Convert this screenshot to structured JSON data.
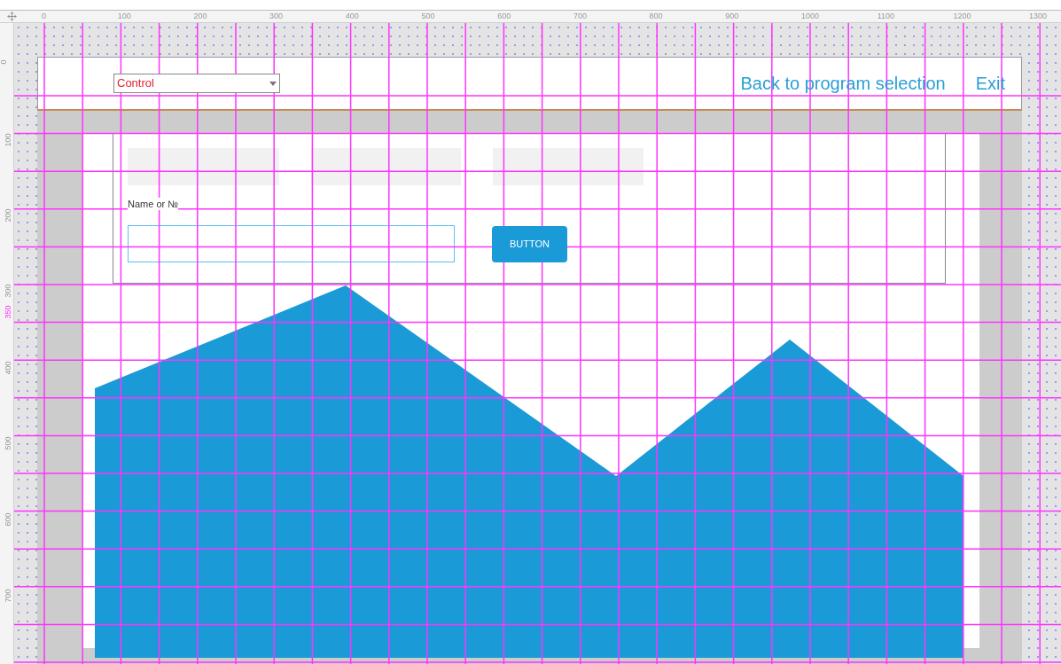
{
  "rulers": {
    "horizontal": [
      {
        "label": "0",
        "highlighted": false
      },
      {
        "label": "100",
        "highlighted": false
      },
      {
        "label": "200",
        "highlighted": false
      },
      {
        "label": "300",
        "highlighted": false
      },
      {
        "label": "400",
        "highlighted": false
      },
      {
        "label": "500",
        "highlighted": false
      },
      {
        "label": "600",
        "highlighted": false
      },
      {
        "label": "700",
        "highlighted": false
      },
      {
        "label": "800",
        "highlighted": false
      },
      {
        "label": "900",
        "highlighted": false
      },
      {
        "label": "1000",
        "highlighted": false
      },
      {
        "label": "1100",
        "highlighted": false
      },
      {
        "label": "1200",
        "highlighted": false
      },
      {
        "label": "1300",
        "highlighted": false
      }
    ],
    "vertical": [
      {
        "label": "0",
        "highlighted": false
      },
      {
        "label": "100",
        "highlighted": false
      },
      {
        "label": "200",
        "highlighted": false
      },
      {
        "label": "300",
        "highlighted": false
      },
      {
        "label": "350",
        "highlighted": true
      },
      {
        "label": "400",
        "highlighted": false
      },
      {
        "label": "500",
        "highlighted": false
      },
      {
        "label": "600",
        "highlighted": false
      },
      {
        "label": "700",
        "highlighted": false
      }
    ]
  },
  "header": {
    "dropdown": {
      "value": "Control"
    },
    "links": [
      "Back to program selection",
      "Exit"
    ]
  },
  "form": {
    "label": "Name or №",
    "button": "BUTTON"
  }
}
